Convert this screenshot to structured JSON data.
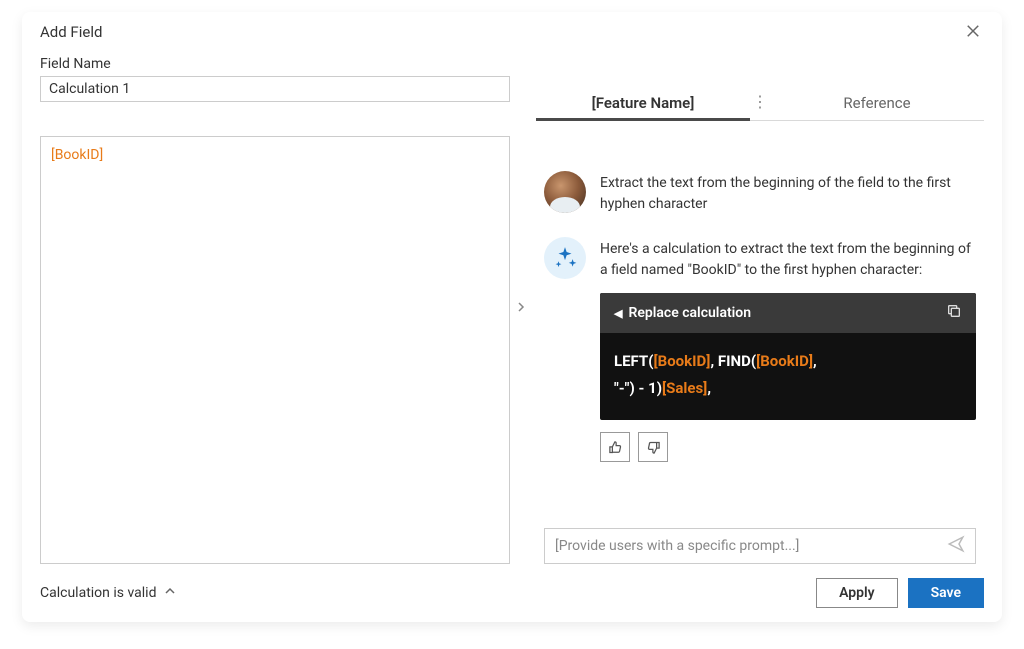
{
  "modal": {
    "title": "Add Field"
  },
  "field": {
    "name_label": "Field Name",
    "name_value": "Calculation 1"
  },
  "formula": {
    "token": "[BookID]"
  },
  "tabs": {
    "feature": "[Feature Name]",
    "reference": "Reference"
  },
  "chat": {
    "user_msg": "Extract the text from the beginning of the field to the first hyphen character",
    "ai_msg": "Here's a calculation to extract the text from the beginning of a field named \"BookID\" to the first hyphen character:",
    "replace_label": "Replace calculation",
    "code_tokens": [
      {
        "t": "kw",
        "v": "LEFT("
      },
      {
        "t": "field",
        "v": "[BookID]"
      },
      {
        "t": "kw",
        "v": ", FIND("
      },
      {
        "t": "field",
        "v": "[BookID]"
      },
      {
        "t": "kw",
        "v": ", "
      },
      {
        "t": "br",
        "v": ""
      },
      {
        "t": "kw",
        "v": "\"-\") - 1)"
      },
      {
        "t": "field",
        "v": "[Sales]"
      },
      {
        "t": "kw",
        "v": ","
      }
    ]
  },
  "prompt": {
    "placeholder": "[Provide users with a specific prompt...]"
  },
  "footer": {
    "validation": "Calculation is valid",
    "apply": "Apply",
    "save": "Save"
  }
}
